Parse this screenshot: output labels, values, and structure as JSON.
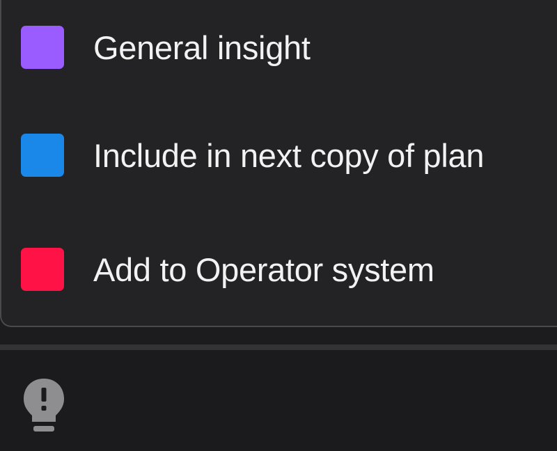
{
  "menu": {
    "items": [
      {
        "label": "General insight",
        "color": "#9b5cff",
        "icon": "purple-swatch"
      },
      {
        "label": "Include in next copy of plan",
        "color": "#1a88e8",
        "icon": "blue-swatch"
      },
      {
        "label": "Add to Operator system",
        "color": "#ff1346",
        "icon": "red-swatch"
      }
    ]
  },
  "toolbar": {
    "icon": "lightbulb-alert-icon",
    "icon_color": "#8e8e90"
  },
  "colors": {
    "background": "#1c1c1e",
    "menu_background": "#232325",
    "text": "#f2f2f2"
  }
}
